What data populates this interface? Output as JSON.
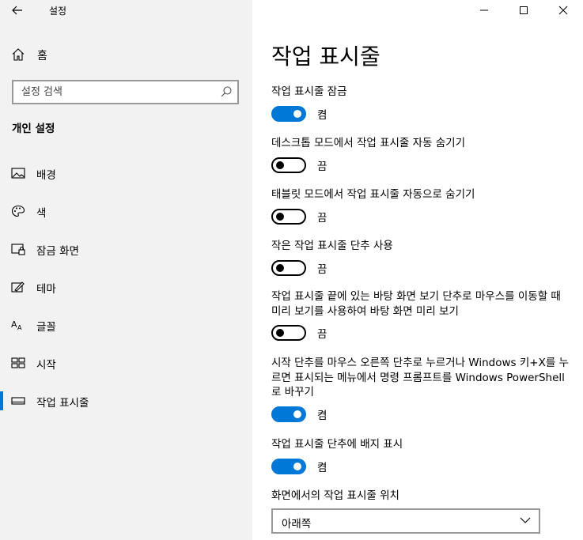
{
  "app": {
    "title": "설정"
  },
  "sidebar": {
    "home_label": "홈",
    "search_placeholder": "설정 검색",
    "section_title": "개인 설정",
    "items": [
      {
        "label": "배경",
        "icon": "picture-icon"
      },
      {
        "label": "색",
        "icon": "palette-icon"
      },
      {
        "label": "잠금 화면",
        "icon": "lock-screen-icon"
      },
      {
        "label": "테마",
        "icon": "theme-icon"
      },
      {
        "label": "글꼴",
        "icon": "font-icon"
      },
      {
        "label": "시작",
        "icon": "start-icon"
      },
      {
        "label": "작업 표시줄",
        "icon": "taskbar-icon",
        "active": true
      }
    ]
  },
  "main": {
    "title": "작업 표시줄",
    "settings": [
      {
        "title": "작업 표시줄 잠금",
        "state": "켬",
        "on": true
      },
      {
        "title": "데스크톱 모드에서 작업 표시줄 자동 숨기기",
        "state": "끔",
        "on": false
      },
      {
        "title": "태블릿 모드에서 작업 표시줄 자동으로 숨기기",
        "state": "끔",
        "on": false
      },
      {
        "title": "작은 작업 표시줄 단추 사용",
        "state": "끔",
        "on": false
      },
      {
        "title": "작업 표시줄 끝에 있는 바탕 화면 보기 단추로 마우스를 이동할 때 미리 보기를 사용하여 바탕 화면 미리 보기",
        "state": "끔",
        "on": false
      },
      {
        "title": "시작 단추를 마우스 오른쪽 단추로 누르거나 Windows 키+X를 누르면 표시되는 메뉴에서 명령 프롬프트를 Windows PowerShell로 바꾸기",
        "state": "켬",
        "on": true
      },
      {
        "title": "작업 표시줄 단추에 배지 표시",
        "state": "켬",
        "on": true
      }
    ],
    "position_label": "화면에서의 작업 표시줄 위치",
    "position_value": "아래쪽"
  },
  "colors": {
    "accent": "#0078d7",
    "sidebar_bg": "#f2f2f2"
  }
}
